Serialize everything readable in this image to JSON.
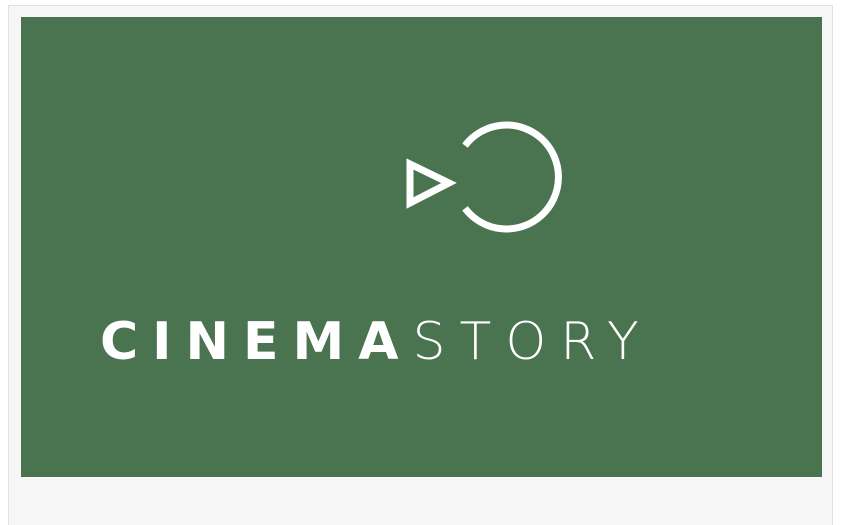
{
  "brand": {
    "wordmark_bold": "CINEMA",
    "wordmark_light": "STORY",
    "icon": "play-circle-c-icon"
  },
  "colors": {
    "banner_background": "#4a7350",
    "logo": "#ffffff",
    "frame_background": "#f6f6f6"
  }
}
